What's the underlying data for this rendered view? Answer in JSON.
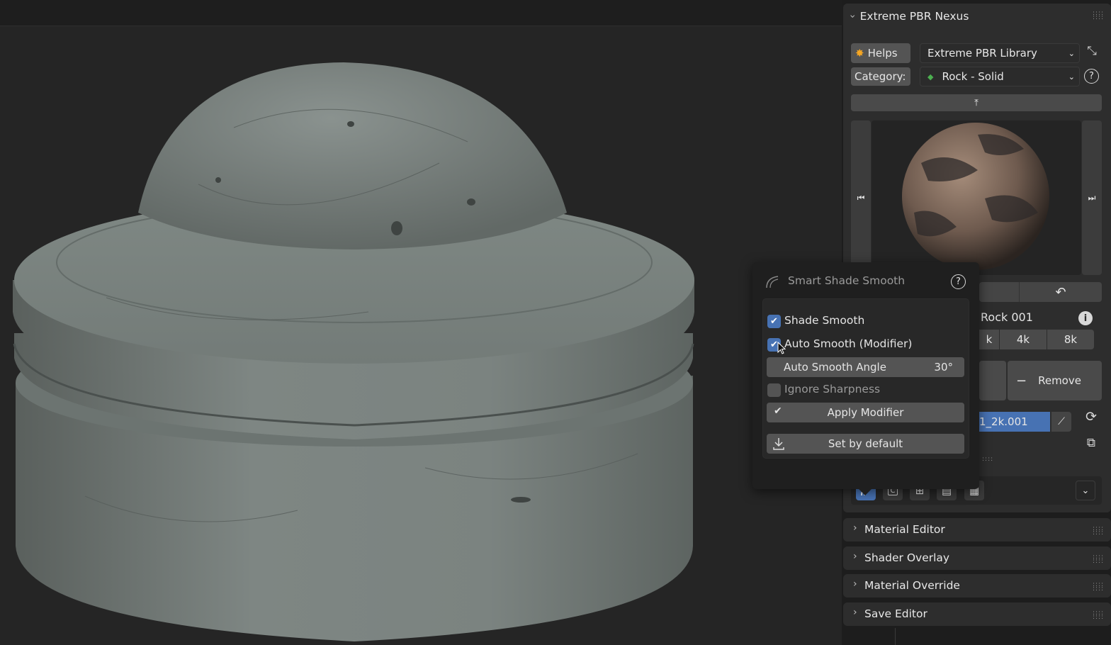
{
  "addon": {
    "panel_title": "Extreme PBR Nexus",
    "helps_label": "Helps",
    "library_value": "Extreme PBR Library",
    "category_label": "Category:",
    "category_value": "Rock - Solid",
    "material_name_partial": "Rock 001",
    "resolution_labels": [
      "k",
      "4k",
      "8k"
    ],
    "remove_label": "Remove",
    "texture_name_partial": "1_2k.001"
  },
  "popup": {
    "title": "Smart Shade Smooth",
    "shade_smooth_label": "Shade Smooth",
    "shade_smooth_checked": true,
    "auto_smooth_label": "Auto Smooth (Modifier)",
    "auto_smooth_checked": true,
    "angle_label": "Auto Smooth Angle",
    "angle_value": "30°",
    "ignore_sharpness_label": "Ignore Sharpness",
    "ignore_sharpness_checked": false,
    "apply_label": "Apply Modifier",
    "default_label": "Set by default"
  },
  "collapsed_panels": [
    {
      "label": "Material Editor"
    },
    {
      "label": "Shader Overlay"
    },
    {
      "label": "Material Override"
    },
    {
      "label": "Save Editor"
    }
  ],
  "colors": {
    "accent_blue": "#4772b3",
    "panel_bg": "#2d2d2d",
    "button_gray": "#545454"
  }
}
